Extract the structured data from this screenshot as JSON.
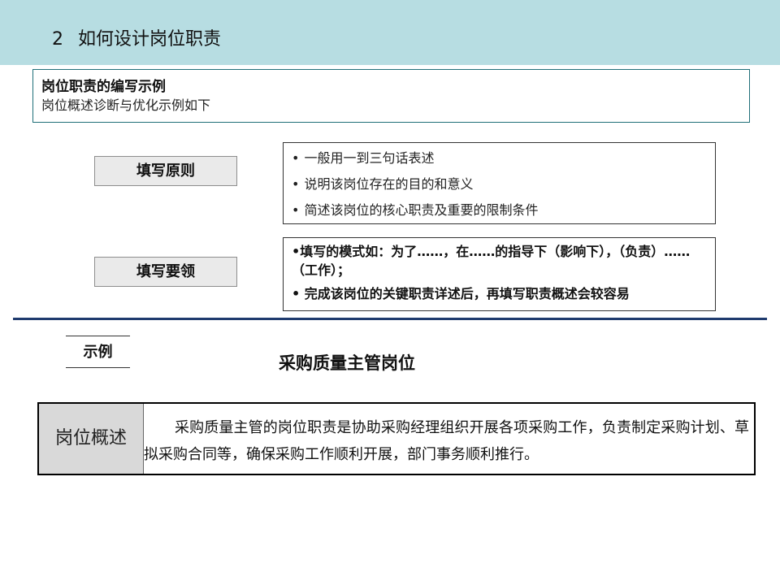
{
  "header": {
    "number": "2",
    "title": "如何设计岗位职责"
  },
  "example_box": {
    "title": "岗位职责的编写示例",
    "subtitle": "岗位概述诊断与优化示例如下"
  },
  "rules": {
    "label": "填写原则",
    "items": [
      "一般用一到三句话表述",
      "说明该岗位存在的目的和意义",
      "简述该岗位的核心职责及重要的限制条件"
    ]
  },
  "tips": {
    "label": "填写要领",
    "items": [
      "•填写的模式如：为了……，在……的指导下（影响下），（负责）……（工作）；",
      "• 完成该岗位的关键职责详述后，再填写职责概述会较容易"
    ]
  },
  "sample": {
    "label": "示例",
    "position_title": "采购质量主管岗位",
    "table": {
      "label": "岗位概述",
      "text": "采购质量主管的岗位职责是协助采购经理组织开展各项采购工作，负责制定采购计划、草拟采购合同等，确保采购工作顺利开展，部门事务顺利推行。"
    }
  },
  "colors": {
    "header_band": "#b7dde2",
    "divider": "#1f3b6e",
    "box_border": "#1f6f78",
    "label_fill": "#eaeaea",
    "table_label_fill": "#d9d9d9"
  }
}
